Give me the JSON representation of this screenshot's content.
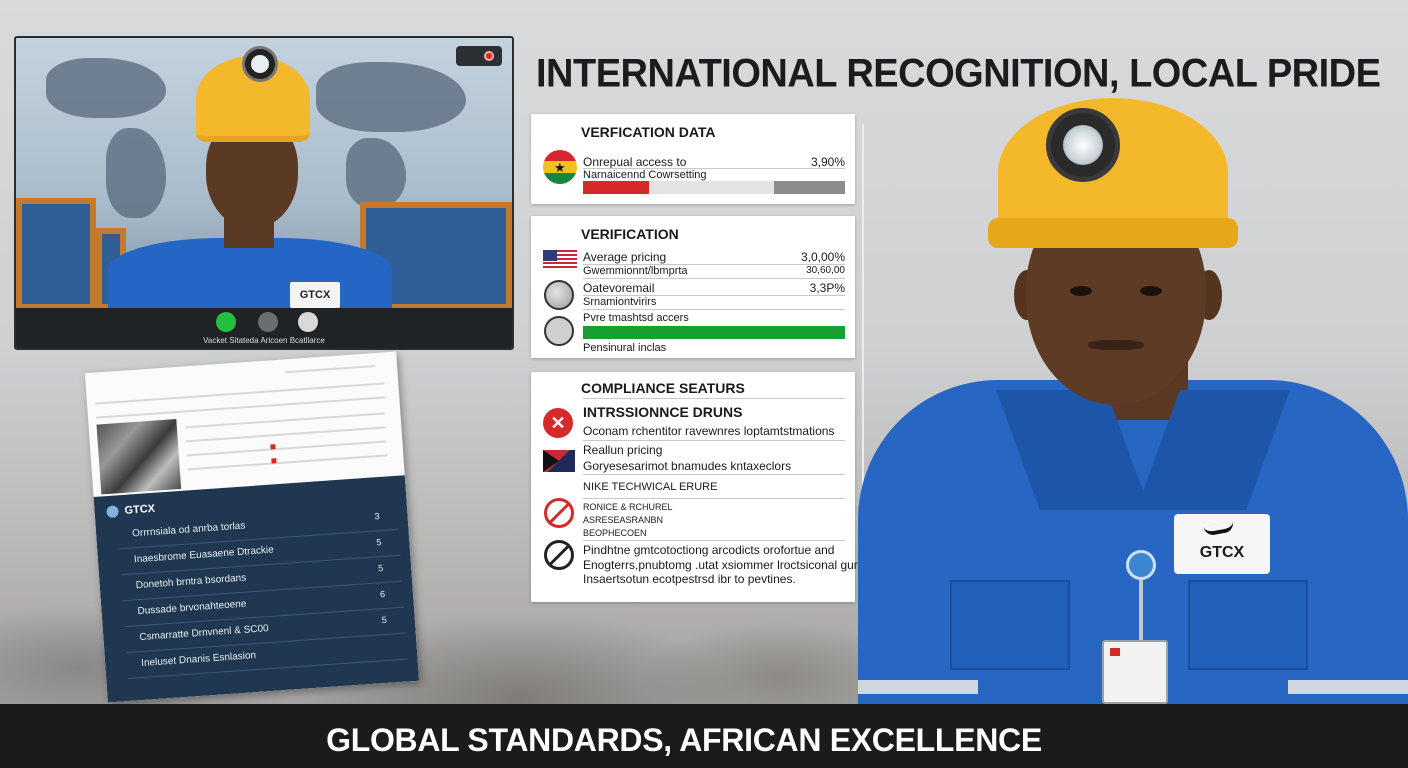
{
  "headline": "INTERNATIONAL RECOGNITION, LOCAL PRIDE",
  "banner": "GLOBAL STANDARDS, AFRICAN EXCELLENCE",
  "video_call": {
    "name_tag": "GTCX",
    "caption": "Vacket Sitateda Aricoen Bcatllarce",
    "controls": [
      "green",
      "gray",
      "light-gray"
    ],
    "control_colors": {
      "green": "#22c03c",
      "gray": "#6b6e71",
      "light": "#d9d9d9"
    }
  },
  "card_verification_data": {
    "title": "VERFICATION DATA",
    "flag_icon": "ghana-flag-icon",
    "line1": "Onrepual access to",
    "line2": "Narnaicennd Cowrsetting",
    "value": "3,90%",
    "bar": {
      "red_fraction": 0.25,
      "gray_start": 0.73,
      "gray_end": 1.0
    }
  },
  "card_verification": {
    "title": "VERIFICATION",
    "rows": [
      {
        "label": "Average pricing",
        "value": "3,0,00%"
      },
      {
        "label": "Gwemmionnt/lbmprta",
        "value": "30,60,00"
      },
      {
        "label": "Oatevoremail",
        "value": "3,3P%"
      },
      {
        "label": "Srnamiontvirirs",
        "value": ""
      },
      {
        "label": "Pvre tmashtsd accers",
        "value": ""
      },
      {
        "label": "Pensinural inclas",
        "value": ""
      }
    ],
    "green_bar_fraction": 1.0
  },
  "card_compliance": {
    "title": "COMPLIANCE SEATURS",
    "subtitle": "INTRSSIONNCE DRUNS",
    "rows": [
      "Oconam rchentitor ravewnres loptamtstmations",
      "Reallun pricing",
      "Goryesesarimot bnamudes kntaxeclors",
      "NIKE TECHWICAL ERURE",
      "RONICE & RCHUREL",
      "ASRESEASRANBN",
      "BEOPHECOEN"
    ],
    "paragraph": [
      "Pindhtne gmtcotoctiong arcodicts orofortue and",
      "Enogterrs,pnubtomg .utat xsiommer lroctsiconal gunfe",
      "Insaertsotun ecotpestrsd ibr to pevtines."
    ]
  },
  "document": {
    "brand": "GTCX",
    "rows": [
      {
        "label": "Orrrnsiala od anrba torlas",
        "num": "3"
      },
      {
        "label": "Inaesbrome Euasaene Dtrackie",
        "num": "5"
      },
      {
        "label": "Donetoh brntra bsordans",
        "num": "5"
      },
      {
        "label": "Dussade brvonahteoene",
        "num": "6"
      },
      {
        "label": "Csmarratte Drnvnenl & SC00",
        "num": "5"
      },
      {
        "label": "Ineluset Dnanis Esnlasion",
        "num": ""
      }
    ]
  },
  "miner": {
    "name_tag": "GTCX"
  },
  "colors": {
    "red": "#d62a2a",
    "green": "#16a030",
    "navy": "#1f3750",
    "shirt_blue": "#2766c2",
    "helmet_yellow": "#f4b92a"
  }
}
